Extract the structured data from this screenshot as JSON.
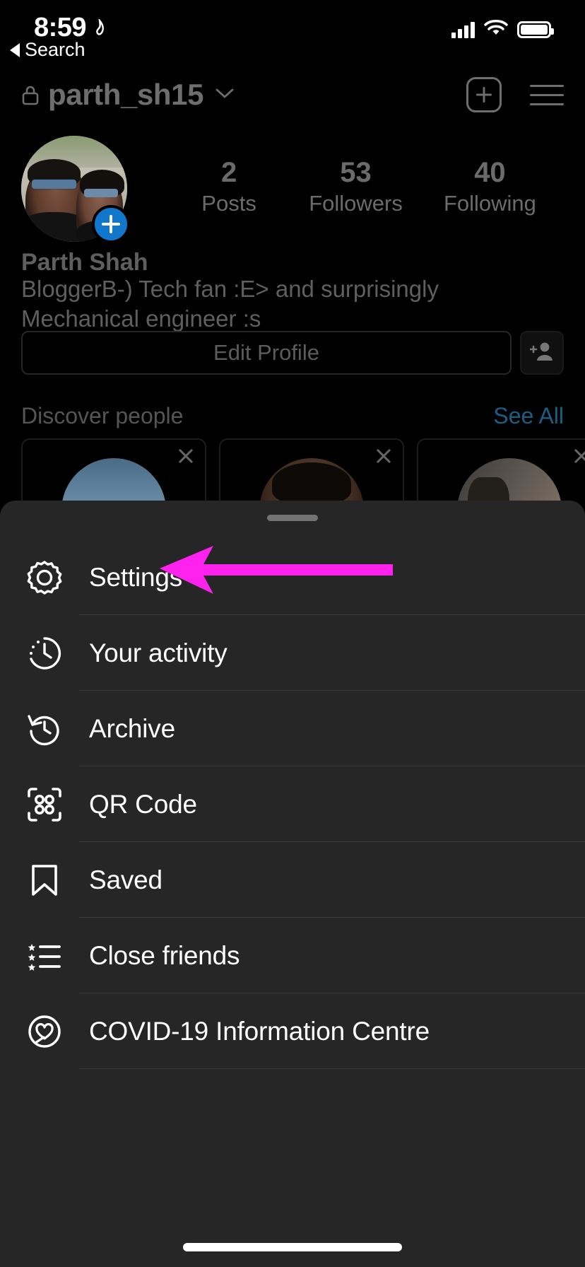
{
  "status_bar": {
    "time": "8:59",
    "location_icon": "location-arrow-icon",
    "signal_icon": "cellular-signal-icon",
    "wifi_icon": "wifi-icon",
    "battery_icon": "battery-full-icon"
  },
  "back_link": {
    "label": "Search",
    "icon": "back-triangle-icon"
  },
  "nav": {
    "lock_icon": "lock-icon",
    "username": "parth_sh15",
    "chevron_icon": "chevron-down-icon",
    "add_icon": "plus-square-icon",
    "menu_icon": "hamburger-menu-icon"
  },
  "profile": {
    "avatar_name": "profile-photo",
    "add_story_icon": "plus-circle-icon",
    "stats": [
      {
        "num": "2",
        "label": "Posts"
      },
      {
        "num": "53",
        "label": "Followers"
      },
      {
        "num": "40",
        "label": "Following"
      }
    ],
    "full_name": "Parth Shah",
    "bio": "BloggerB-) Tech fan :E> and surprisingly Mechanical engineer :s",
    "edit_button": "Edit Profile",
    "add_person_icon": "add-person-icon"
  },
  "discover": {
    "title": "Discover people",
    "see_all": "See All",
    "cards": [
      {
        "name": "suggested-user-1",
        "close_icon": "close-icon"
      },
      {
        "name": "suggested-user-2",
        "close_icon": "close-icon"
      },
      {
        "name": "suggested-user-3",
        "close_icon": "close-icon"
      }
    ]
  },
  "sheet": {
    "handle": "drag-handle",
    "items": [
      {
        "label": "Settings",
        "icon": "gear-icon"
      },
      {
        "label": "Your activity",
        "icon": "activity-clock-icon"
      },
      {
        "label": "Archive",
        "icon": "archive-clock-icon"
      },
      {
        "label": "QR Code",
        "icon": "qr-code-icon"
      },
      {
        "label": "Saved",
        "icon": "bookmark-icon"
      },
      {
        "label": "Close friends",
        "icon": "star-list-icon"
      },
      {
        "label": "COVID-19 Information Centre",
        "icon": "heart-circle-icon"
      }
    ]
  },
  "annotation": {
    "arrow_color": "#ff22ee",
    "points_to": "Settings"
  },
  "colors": {
    "page_bg": "#000000",
    "sheet_bg": "#262626",
    "divider": "#3a3a3a",
    "muted_text": "#5f5f5f",
    "link_blue": "#1b5e85",
    "story_blue": "#1177cc"
  },
  "home_indicator": "home-indicator"
}
